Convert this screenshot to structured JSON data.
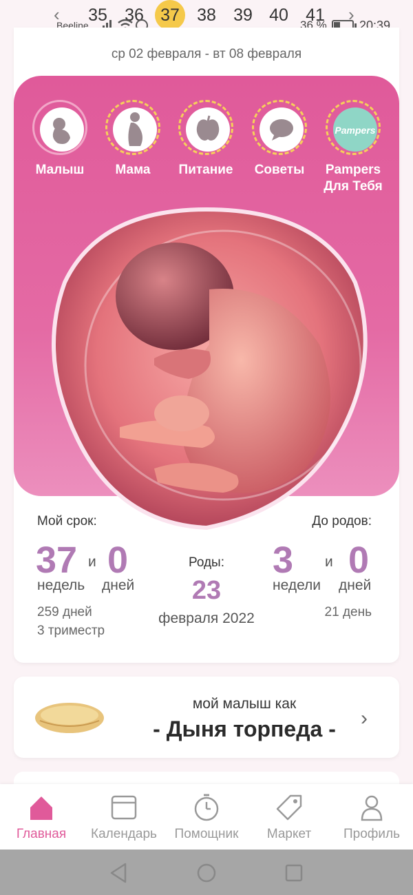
{
  "status_bar": {
    "carrier": "Beeline",
    "battery_text": "36 %",
    "battery_level": 0.36,
    "time": "20:39"
  },
  "week_selector": {
    "weeks": [
      "35",
      "36",
      "37",
      "38",
      "39",
      "40",
      "41"
    ],
    "selected": "37",
    "date_range": "ср 02 февраля - вт 08 февраля"
  },
  "topics": [
    {
      "label": "Малыш",
      "icon": "baby-icon"
    },
    {
      "label": "Мама",
      "icon": "mother-icon"
    },
    {
      "label": "Питание",
      "icon": "apple-icon"
    },
    {
      "label": "Советы",
      "icon": "speech-bubble-icon"
    },
    {
      "label": "Pampers\nДля Тебя",
      "icon": "pampers-logo-icon"
    }
  ],
  "pampers_logo_text": "Pampers",
  "stats": {
    "my_term_label": "Мой срок:",
    "weeks_value": "37",
    "and1": "и",
    "days_value": "0",
    "weeks_unit": "недель",
    "days_unit": "дней",
    "days_total": "259 дней",
    "trimester": "3 триместр",
    "birth_label": "Роды:",
    "birth_day": "23",
    "birth_month_year": "февраля 2022",
    "until_label": "До родов:",
    "until_weeks": "3",
    "and2": "и",
    "until_days": "0",
    "until_weeks_unit": "недели",
    "until_days_unit": "дней",
    "until_total": "21 день"
  },
  "baby_size": {
    "prefix": "мой малыш как",
    "name": "- Дыня торпеда -"
  },
  "tabs": [
    {
      "label": "Главная",
      "icon": "home-icon",
      "active": true
    },
    {
      "label": "Календарь",
      "icon": "calendar-icon",
      "active": false
    },
    {
      "label": "Помощник",
      "icon": "stopwatch-icon",
      "active": false
    },
    {
      "label": "Маркет",
      "icon": "tag-icon",
      "active": false
    },
    {
      "label": "Профиль",
      "icon": "profile-icon",
      "active": false
    }
  ],
  "colors": {
    "accent_pink": "#e05a9a",
    "number_purple": "#b07ab4",
    "week_highlight": "#f5c94a"
  }
}
